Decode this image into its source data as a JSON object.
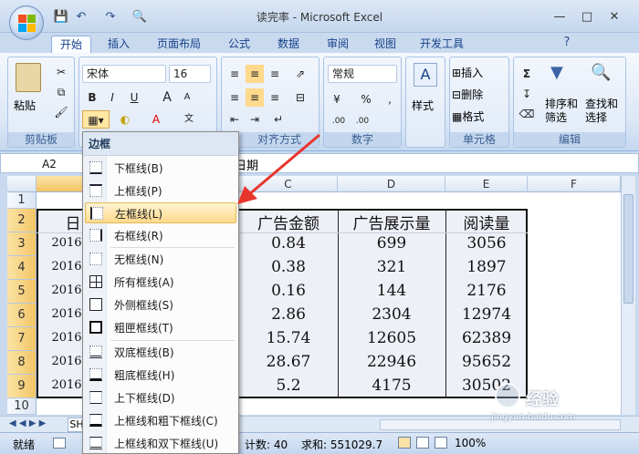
{
  "window": {
    "title": "读完率 - Microsoft Excel"
  },
  "ribbon_tabs": [
    "开始",
    "插入",
    "页面布局",
    "公式",
    "数据",
    "审阅",
    "视图",
    "开发工具"
  ],
  "clipboard": {
    "paste_label": "粘贴",
    "group_label": "剪贴板"
  },
  "font": {
    "name": "宋体",
    "size": "16",
    "bold": "B",
    "italic": "I",
    "underline": "U",
    "grow": "A",
    "shrink": "A",
    "group_label": "字体"
  },
  "alignment": {
    "group_label": "对齐方式"
  },
  "number": {
    "format": "常规",
    "percent": "%",
    "comma": ",",
    "inc_decimal": ".00",
    "dec_decimal": ".00",
    "group_label": "数字"
  },
  "styles": {
    "label": "样式"
  },
  "cells": {
    "insert": "插入",
    "delete": "删除",
    "format": "格式",
    "group_label": "单元格"
  },
  "editing": {
    "sort_filter": "排序和\n筛选",
    "find_select": "查找和\n选择",
    "group_label": "编辑"
  },
  "formula_bar": {
    "name_box": "A2",
    "content": "日期"
  },
  "columns": [
    "C",
    "D",
    "E",
    "F"
  ],
  "rows": [
    "1",
    "2",
    "3",
    "4",
    "5",
    "6",
    "7",
    "8",
    "9",
    "10"
  ],
  "table": {
    "headers": [
      "广告金额",
      "广告展示量",
      "阅读量"
    ],
    "left_col": [
      "日",
      "2016",
      "2016",
      "2016",
      "2016",
      "2016",
      "2016",
      "2016"
    ],
    "rows": [
      [
        "0.84",
        "699",
        "3056"
      ],
      [
        "0.38",
        "321",
        "1897"
      ],
      [
        "0.16",
        "144",
        "2176"
      ],
      [
        "2.86",
        "2304",
        "12974"
      ],
      [
        "15.74",
        "12605",
        "62389"
      ],
      [
        "28.67",
        "22946",
        "95652"
      ],
      [
        "5.2",
        "4175",
        "30502"
      ]
    ]
  },
  "sheet_tab": "SH",
  "status": {
    "ready": "就绪",
    "count": "计数: 40",
    "sum": "求和: 551029.7",
    "zoom": "100%"
  },
  "border_menu": {
    "title": "边框",
    "items": [
      {
        "label": "下框线(B)"
      },
      {
        "label": "上框线(P)"
      },
      {
        "label": "左框线(L)"
      },
      {
        "label": "右框线(R)"
      },
      {
        "label": "无框线(N)"
      },
      {
        "label": "所有框线(A)"
      },
      {
        "label": "外侧框线(S)"
      },
      {
        "label": "粗匣框线(T)"
      },
      {
        "label": "双底框线(B)"
      },
      {
        "label": "粗底框线(H)"
      },
      {
        "label": "上下框线(D)"
      },
      {
        "label": "上框线和粗下框线(C)"
      },
      {
        "label": "上框线和双下框线(U)"
      }
    ],
    "highlighted_index": 2
  },
  "watermark": {
    "site": "jingyan.baidu.com"
  },
  "colors": {
    "accent": "#15428b",
    "highlight": "#ffd98c",
    "arrow": "#e8352c"
  }
}
